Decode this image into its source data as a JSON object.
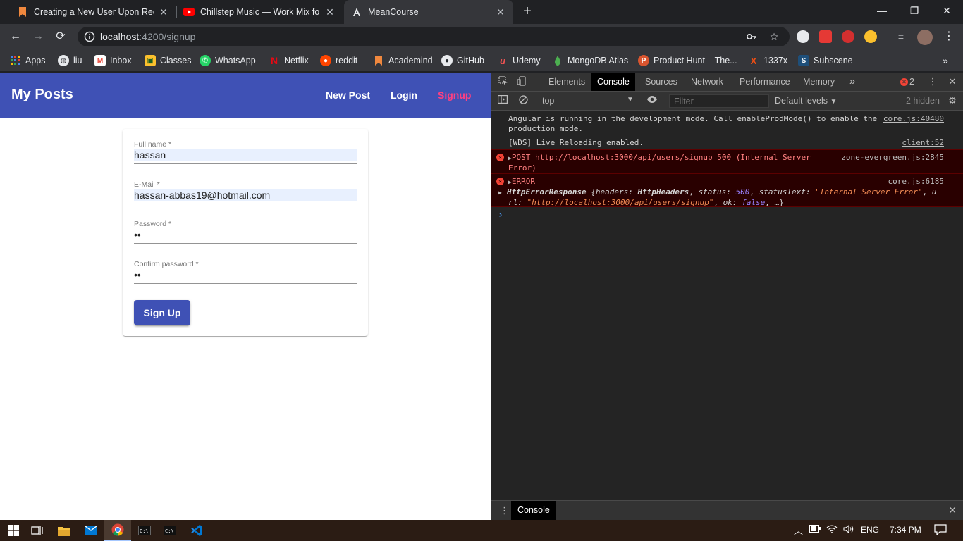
{
  "browser": {
    "tabs": [
      {
        "title": "Creating a New User Upon Reque",
        "icon": "bookmark-orange-icon"
      },
      {
        "title": "Chillstep Music — Work Mix for F",
        "icon": "youtube-icon"
      },
      {
        "title": "MeanCourse",
        "icon": "angular-icon"
      }
    ],
    "url_host": "localhost",
    "url_path": ":4200/signup",
    "bookmarks": [
      {
        "label": "Apps",
        "icon": "apps-grid-icon"
      },
      {
        "label": "liu",
        "icon": "globe-icon"
      },
      {
        "label": "Inbox",
        "icon": "gmail-icon"
      },
      {
        "label": "Classes",
        "icon": "classroom-icon"
      },
      {
        "label": "WhatsApp",
        "icon": "whatsapp-icon"
      },
      {
        "label": "Netflix",
        "icon": "netflix-icon"
      },
      {
        "label": "reddit",
        "icon": "reddit-icon"
      },
      {
        "label": "Academind",
        "icon": "bookmark-orange-icon"
      },
      {
        "label": "GitHub",
        "icon": "github-icon"
      },
      {
        "label": "Udemy",
        "icon": "udemy-icon"
      },
      {
        "label": "MongoDB Atlas",
        "icon": "mongodb-icon"
      },
      {
        "label": "Product Hunt – The...",
        "icon": "producthunt-icon"
      },
      {
        "label": "1337x",
        "icon": "1337x-icon"
      },
      {
        "label": "Subscene",
        "icon": "subscene-icon"
      }
    ]
  },
  "app": {
    "brand": "My Posts",
    "nav": [
      "New Post",
      "Login",
      "Signup"
    ],
    "active_nav": "Signup",
    "primary_color": "#3f51b5",
    "accent_color": "#ff4081"
  },
  "form": {
    "fullname_label": "Full name *",
    "fullname_value": "hassan",
    "email_label": "E-Mail *",
    "email_value": "hassan-abbas19@hotmail.com",
    "password_label": "Password *",
    "password_value": "••",
    "confirm_label": "Confirm password *",
    "confirm_value": "••",
    "submit_label": "Sign Up"
  },
  "devtools": {
    "tabs": [
      "Elements",
      "Console",
      "Sources",
      "Network",
      "Performance",
      "Memory"
    ],
    "active_tab": "Console",
    "error_count": "2",
    "context": "top",
    "filter_placeholder": "Filter",
    "levels": "Default levels",
    "hidden": "2 hidden",
    "drawer_tab": "Console",
    "messages": {
      "m1_line1": "Angular is running in the development mode. Call enableProdMode() to enable the",
      "m1_line2": "production mode.",
      "m1_src": "core.js:40480",
      "m2_text": "[WDS] Live Reloading enabled.",
      "m2_src": "client:52",
      "m3_method": "POST",
      "m3_url": "http://localhost:3000/api/users/signup",
      "m3_rest": "500 (Internal Server",
      "m3_line2": "Error)",
      "m3_src": "zone-evergreen.js:2845",
      "m4_label": "ERROR",
      "m4_src": "core.js:6185",
      "m4_class": "HttpErrorResponse",
      "m4_k_headers": "headers:",
      "m4_v_headers": "HttpHeaders",
      "m4_k_status": "status:",
      "m4_v_status": "500",
      "m4_k_statusText": "statusText:",
      "m4_v_statusText": "\"Internal Server Error\"",
      "m4_k_url_a": "u",
      "m4_k_url_b": "rl:",
      "m4_v_url": "\"http://localhost:3000/api/users/signup\"",
      "m4_k_ok": "ok:",
      "m4_v_ok": "false",
      "m4_tail": "…}"
    }
  },
  "taskbar": {
    "language": "ENG",
    "time": "7:34 PM"
  }
}
